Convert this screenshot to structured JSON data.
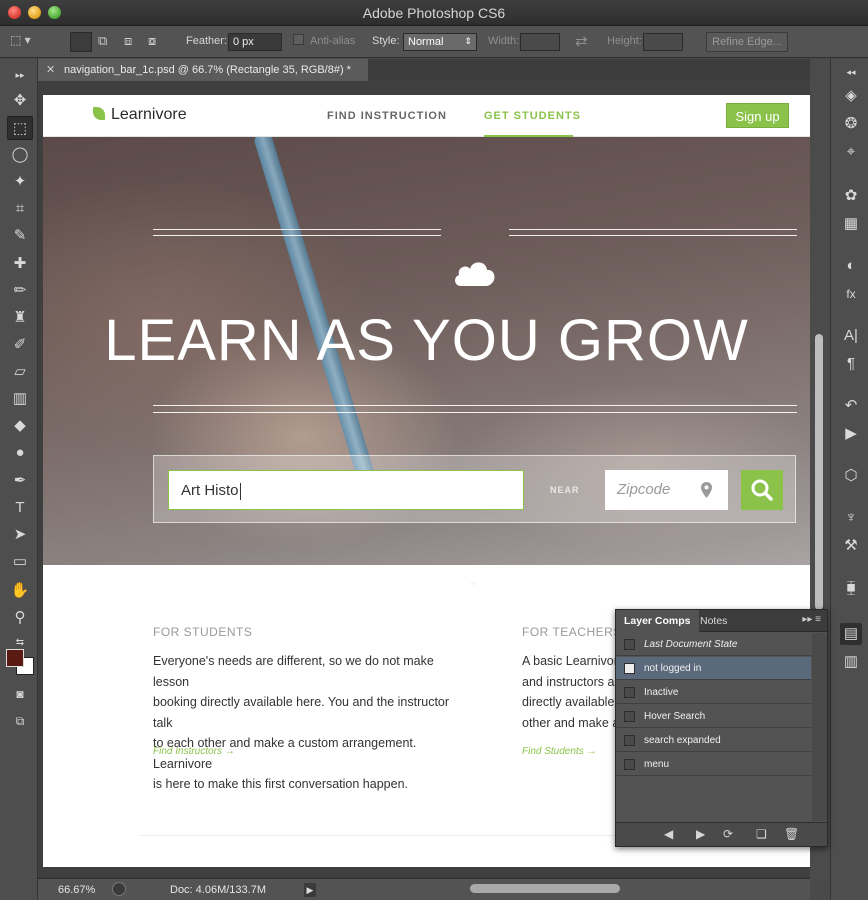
{
  "window": {
    "title": "Adobe Photoshop CS6"
  },
  "options_bar": {
    "feather_label": "Feather:",
    "feather_value": "0 px",
    "anti_alias_label": "Anti-alias",
    "style_label": "Style:",
    "style_value": "Normal",
    "width_label": "Width:",
    "height_label": "Height:",
    "refine_edge_label": "Refine Edge..."
  },
  "document": {
    "tab_label": "navigation_bar_1c.psd @ 66.7% (Rectangle 35, RGB/8#) *"
  },
  "site": {
    "logo": "Learnivore",
    "nav_find": "FIND INSTRUCTION",
    "nav_get": "GET STUDENTS",
    "signup": "Sign up",
    "hero_title": "LEARN AS YOU GROW",
    "search_value": "Art Histo",
    "near_label": "NEAR",
    "zip_placeholder": "Zipcode",
    "students_heading": "FOR STUDENTS",
    "students_lines": [
      "Everyone's needs are different, so we do not make lesson",
      "booking directly available here. You and the instructor talk",
      "to each other and make a custom arrangement. Learnivore",
      "is here to make this first conversation happen."
    ],
    "students_link": "Find Instructors →",
    "teachers_heading": "FOR TEACHERS",
    "teachers_lines": [
      "A basic Learnivore",
      "and instructors are",
      "directly available h",
      "other and make a c"
    ],
    "teachers_link": "Find Students →"
  },
  "status_bar": {
    "zoom": "66.67%",
    "doc_size": "Doc: 4.06M/133.7M"
  },
  "layer_comps": {
    "tab_active": "Layer Comps",
    "tab_other": "Notes",
    "rows": [
      {
        "label": "Last Document State"
      },
      {
        "label": "not logged in"
      },
      {
        "label": "Inactive"
      },
      {
        "label": "Hover Search"
      },
      {
        "label": "search expanded"
      },
      {
        "label": "menu"
      }
    ]
  },
  "colors": {
    "brand_green": "#8bc34a",
    "ps_panel": "#535353",
    "selected_row": "#5a6a7c"
  }
}
